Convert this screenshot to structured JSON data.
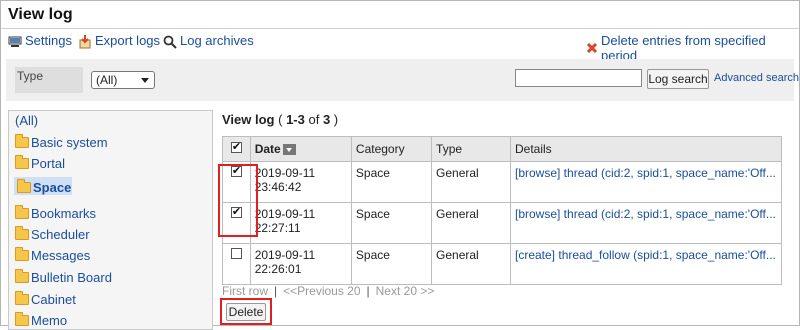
{
  "header": {
    "title": "View log"
  },
  "toolbar": {
    "settings": "Settings",
    "export": "Export logs",
    "archives": "Log archives",
    "delete_entries": "Delete entries from specified period"
  },
  "filter": {
    "type_label": "Type",
    "type_value": "(All)",
    "search_button": "Log search",
    "advanced_search": "Advanced search"
  },
  "sidebar": {
    "all": "(All)",
    "items": [
      "Basic system",
      "Portal",
      "Space",
      "Bookmarks",
      "Scheduler",
      "Messages",
      "Bulletin Board",
      "Cabinet",
      "Memo"
    ],
    "selected": "Space"
  },
  "list": {
    "title": "View log",
    "range_prefix": "( ",
    "range": "1-3",
    "of": " of ",
    "total": "3",
    "range_suffix": " )",
    "columns": {
      "date": "Date",
      "category": "Category",
      "type": "Type",
      "details": "Details"
    },
    "rows": [
      {
        "checked": true,
        "date": "2019-09-11",
        "time": "23:46:42",
        "category": "Space",
        "type": "General",
        "details": "[browse] thread (cid:2, spid:1, space_name:'Off..."
      },
      {
        "checked": true,
        "date": "2019-09-11",
        "time": "22:27:11",
        "category": "Space",
        "type": "General",
        "details": "[browse] thread (cid:2, spid:1, space_name:'Off..."
      },
      {
        "checked": false,
        "date": "2019-09-11",
        "time": "22:26:01",
        "category": "Space",
        "type": "General",
        "details": "[create] thread_follow (spid:1, space_name:'Off..."
      }
    ]
  },
  "pager": {
    "first": "First row",
    "prev": "<<Previous 20",
    "next": "Next 20 >>"
  },
  "actions": {
    "delete": "Delete"
  },
  "colors": {
    "link": "#1a4d9c",
    "highlight_border": "#e02020",
    "delete_icon": "#e04020"
  }
}
